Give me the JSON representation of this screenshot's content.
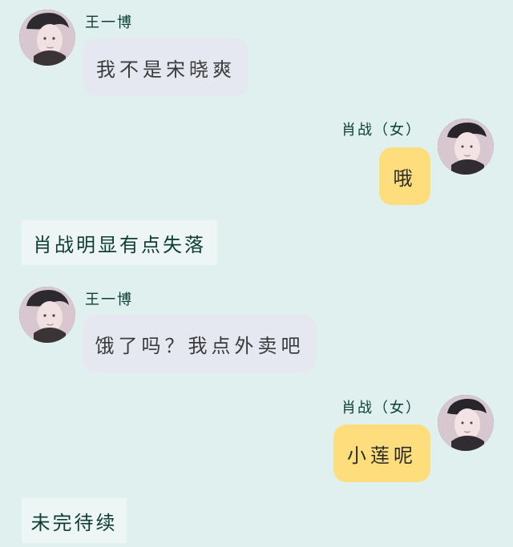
{
  "colors": {
    "background": "#dff0ef",
    "bubble_gray": "#e5e8f0",
    "bubble_yellow": "#fddd7c",
    "narration_bg": "#eef6f5",
    "name_text": "#0c3f34"
  },
  "messages": [
    {
      "sender": "王一博",
      "text": "我不是宋晓爽",
      "avatar": "avatar-wang-yibo"
    },
    {
      "sender": "肖战（女）",
      "text": "哦",
      "avatar": "avatar-xiao-zhan"
    },
    {
      "narration": "肖战明显有点失落"
    },
    {
      "sender": "王一博",
      "text": "饿了吗？我点外卖吧",
      "avatar": "avatar-wang-yibo"
    },
    {
      "sender": "肖战（女）",
      "text": "小莲呢",
      "avatar": "avatar-xiao-zhan"
    },
    {
      "narration": "未完待续"
    }
  ]
}
